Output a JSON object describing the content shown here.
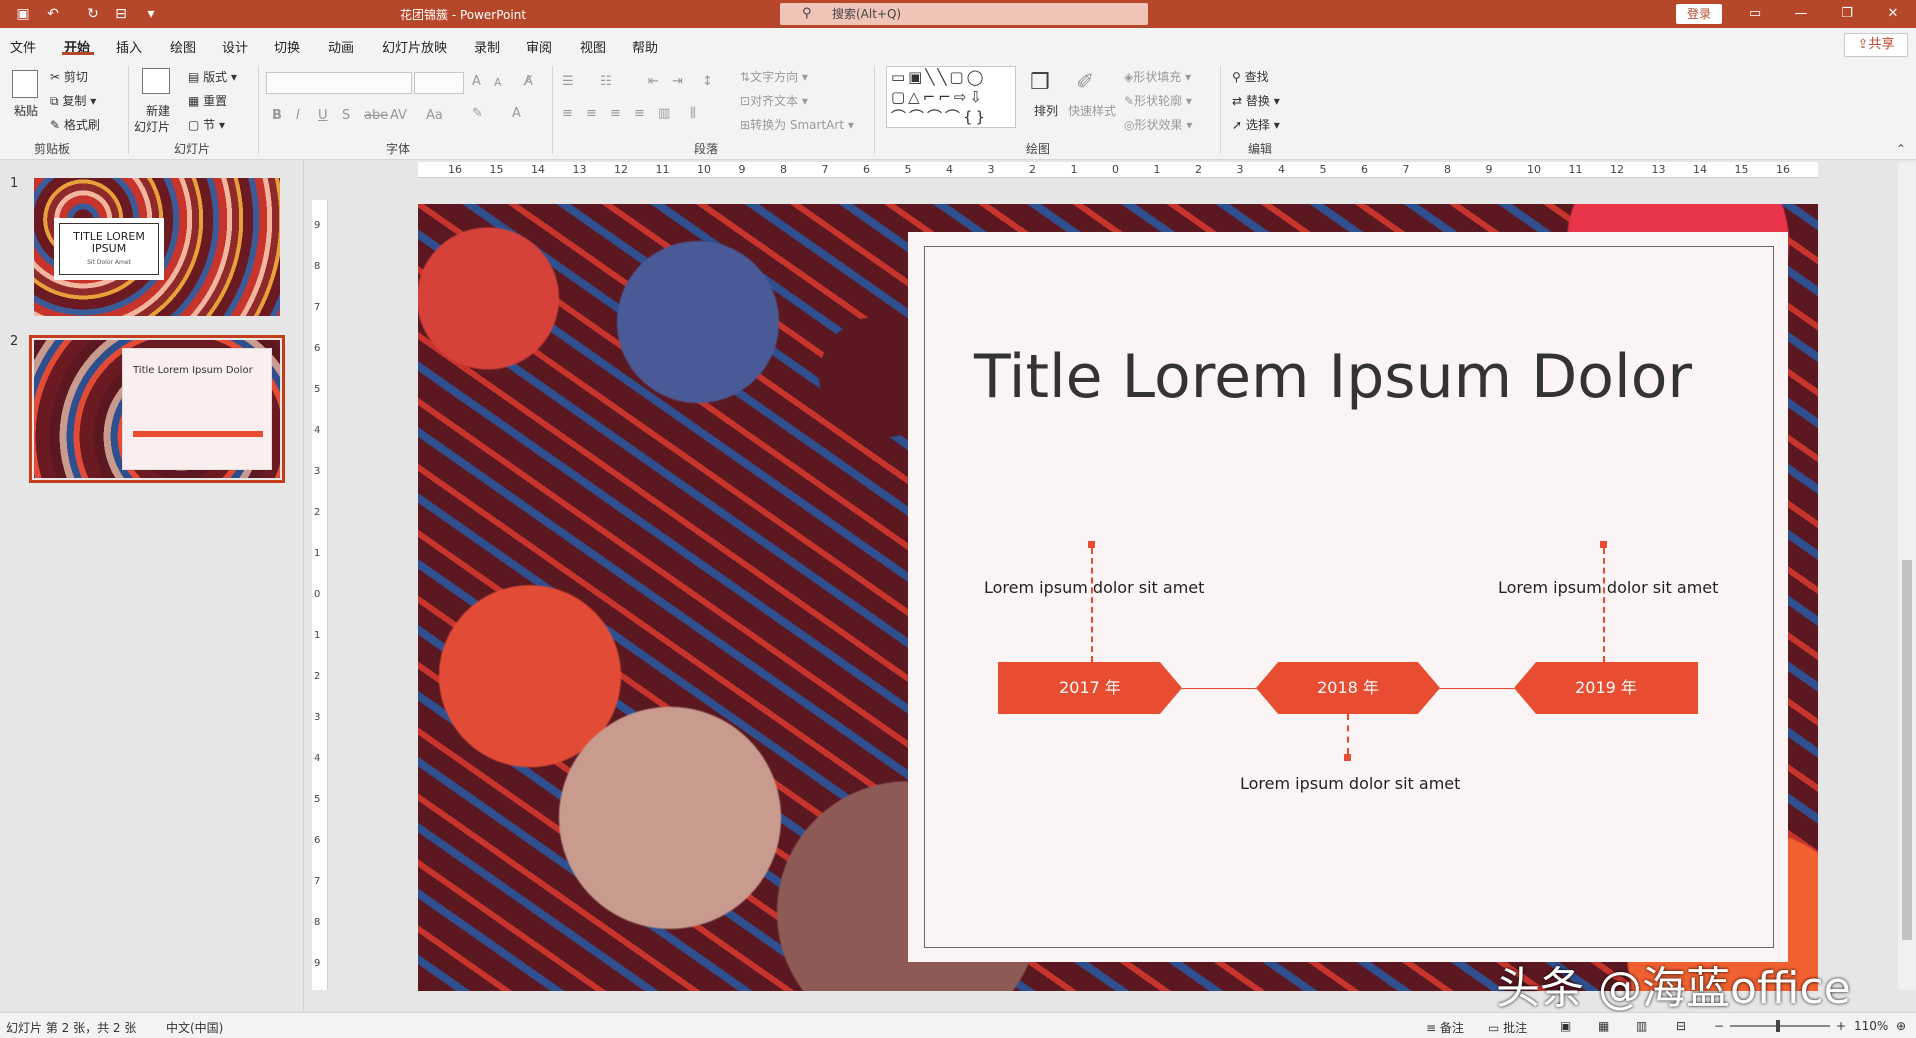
{
  "window": {
    "title": "花团锦簇 - PowerPoint",
    "search_placeholder": "搜索(Alt+Q)",
    "login": "登录"
  },
  "menu": [
    "文件",
    "开始",
    "插入",
    "绘图",
    "设计",
    "切换",
    "动画",
    "幻灯片放映",
    "录制",
    "审阅",
    "视图",
    "帮助"
  ],
  "active_tab": "开始",
  "share": "共享",
  "ribbon": {
    "clipboard": {
      "paste": "粘贴",
      "cut": "剪切",
      "copy": "复制",
      "format_painter": "格式刷",
      "label": "剪贴板"
    },
    "slides": {
      "new_slide": "新建",
      "new_slide2": "幻灯片",
      "layout": "版式",
      "reset": "重置",
      "section": "节",
      "label": "幻灯片"
    },
    "font": {
      "label": "字体",
      "bold": "B",
      "italic": "I",
      "underline": "U",
      "shadow": "S",
      "strike": "abe",
      "spacing": "AV",
      "case": "Aa",
      "inc": "A",
      "dec": "A"
    },
    "paragraph": {
      "label": "段落",
      "text_direction": "文字方向",
      "align_text": "对齐文本",
      "smartart": "转换为 SmartArt"
    },
    "drawing": {
      "label": "绘图",
      "arrange": "排列",
      "quick_styles": "快速样式",
      "fill": "形状填充",
      "outline": "形状轮廓",
      "effects": "形状效果"
    },
    "editing": {
      "label": "编辑",
      "find": "查找",
      "replace": "替换",
      "select": "选择"
    }
  },
  "thumbnails": [
    {
      "num": "1",
      "title": "TITLE LOREM IPSUM",
      "subtitle": "Sit Dolor Amet"
    },
    {
      "num": "2",
      "title": "Title Lorem Ipsum Dolor"
    }
  ],
  "ruler_h": [
    "16",
    "15",
    "14",
    "13",
    "12",
    "11",
    "10",
    "9",
    "8",
    "7",
    "6",
    "5",
    "4",
    "3",
    "2",
    "1",
    "0",
    "1",
    "2",
    "3",
    "4",
    "5",
    "6",
    "7",
    "8",
    "9",
    "10",
    "11",
    "12",
    "13",
    "14",
    "15",
    "16"
  ],
  "ruler_v": [
    "9",
    "8",
    "7",
    "6",
    "5",
    "4",
    "3",
    "2",
    "1",
    "0",
    "1",
    "2",
    "3",
    "4",
    "5",
    "6",
    "7",
    "8",
    "9"
  ],
  "slide": {
    "title": "Title Lorem Ipsum Dolor",
    "years": [
      "2017 年",
      "2018 年",
      "2019 年"
    ],
    "captions": {
      "left": "Lorem ipsum dolor sit amet",
      "right": "Lorem ipsum dolor sit amet",
      "bottom": "Lorem ipsum dolor sit amet"
    }
  },
  "status": {
    "slide_info": "幻灯片 第 2 张，共 2 张",
    "language": "中文(中国)",
    "notes": "备注",
    "comments": "批注",
    "zoom": "110%"
  },
  "watermark": "头条 @海蓝office",
  "colors": {
    "titlebar": "#b7472a",
    "accent": "#e94d31"
  }
}
